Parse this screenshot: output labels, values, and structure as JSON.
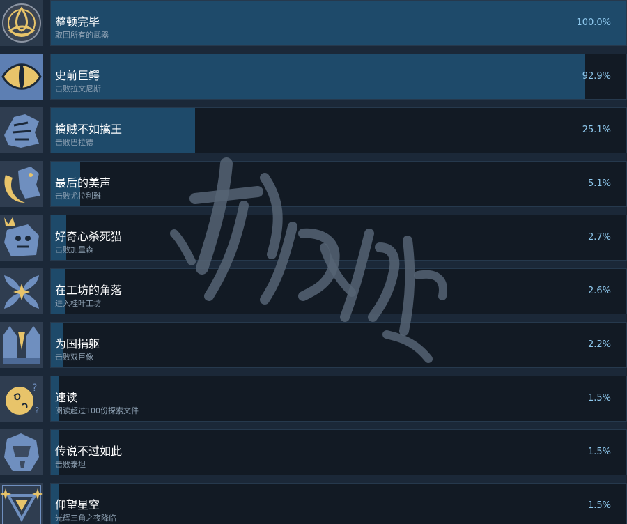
{
  "colors": {
    "background": "#1b2838",
    "card": "#121a24",
    "progress_fill": "#1e4a6a",
    "percent_text": "#8fc9ee",
    "icon_blue": "#6f8fbf",
    "icon_gold": "#e8c46a"
  },
  "achievements": [
    {
      "title": "整顿完毕",
      "description": "取回所有的武器",
      "percent_label": "100.0%",
      "percent": 100.0,
      "icon": "triquetra-knot-icon"
    },
    {
      "title": "史前巨鳄",
      "description": "击败拉文尼斯",
      "percent_label": "92.9%",
      "percent": 92.9,
      "icon": "reptile-eye-icon"
    },
    {
      "title": "擒贼不如擒王",
      "description": "击败巴拉德",
      "percent_label": "25.1%",
      "percent": 25.1,
      "icon": "beast-head-icon"
    },
    {
      "title": "最后的美声",
      "description": "击败尤拉利雅",
      "percent_label": "5.1%",
      "percent": 5.1,
      "icon": "bird-crescent-icon"
    },
    {
      "title": "好奇心杀死猫",
      "description": "击败加里森",
      "percent_label": "2.7%",
      "percent": 2.7,
      "icon": "crowned-cat-icon"
    },
    {
      "title": "在工坊的角落",
      "description": "进入桂叶工坊",
      "percent_label": "2.6%",
      "percent": 2.6,
      "icon": "leaf-flower-icon"
    },
    {
      "title": "为国捐躯",
      "description": "击败双巨像",
      "percent_label": "2.2%",
      "percent": 2.2,
      "icon": "twin-statues-icon"
    },
    {
      "title": "速读",
      "description": "阅读超过100份探索文件",
      "percent_label": "1.5%",
      "percent": 1.5,
      "icon": "swirl-face-icon"
    },
    {
      "title": "传说不过如此",
      "description": "击败泰坦",
      "percent_label": "1.5%",
      "percent": 1.5,
      "icon": "titan-armor-icon"
    },
    {
      "title": "仰望星空",
      "description": "光辉三角之夜降临",
      "percent_label": "1.5%",
      "percent": 1.5,
      "icon": "star-triangle-icon"
    }
  ],
  "watermark": {
    "text": "游侠网"
  }
}
